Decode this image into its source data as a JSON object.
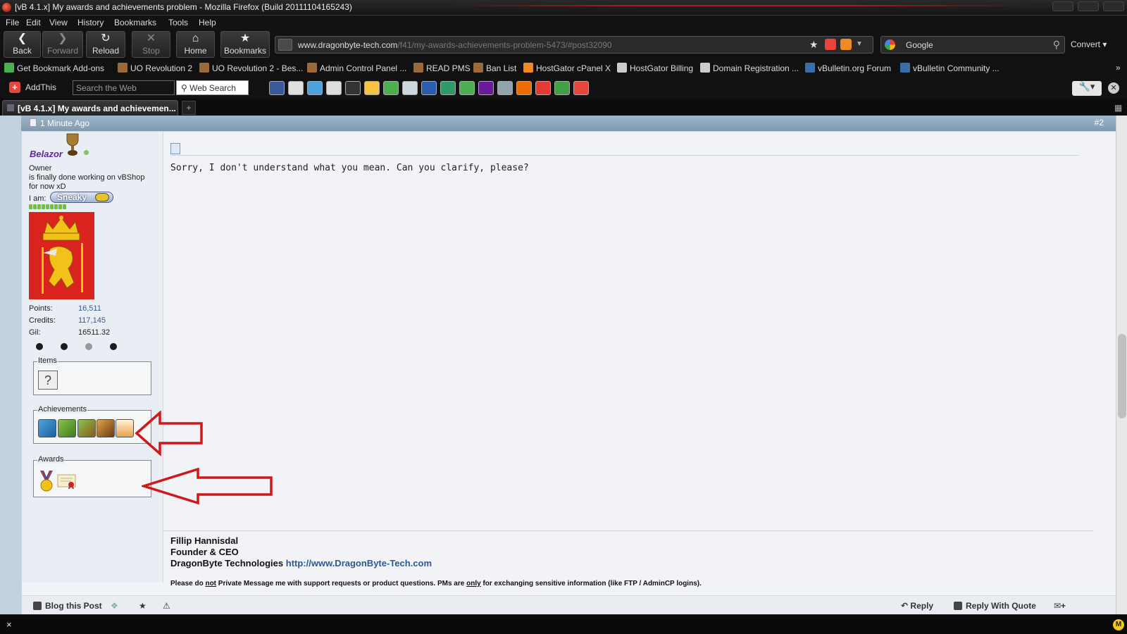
{
  "window": {
    "title": "[vB 4.1.x] My awards and achievements problem - Mozilla Firefox (Build 20111104165243)"
  },
  "menu": [
    "File",
    "Edit",
    "View",
    "History",
    "Bookmarks",
    "Tools",
    "Help"
  ],
  "nav": {
    "back": "Back",
    "forward": "Forward",
    "reload": "Reload",
    "stop": "Stop",
    "home": "Home",
    "bookmarks": "Bookmarks"
  },
  "address": {
    "url_domain": "www.dragonbyte-tech.com",
    "url_path": "/f41/my-awards-achievements-problem-5473/#post32090"
  },
  "search": {
    "engine_text": "Google",
    "convert_label": "Convert"
  },
  "bookmarks_bar": [
    {
      "label": "Get Bookmark Add-ons",
      "icon": "puzzle-icon",
      "color": "#4caf50"
    },
    {
      "label": "UO Revolution 2",
      "icon": "dragon-icon",
      "color": "#9a6a3a"
    },
    {
      "label": "UO Revolution 2 - Bes...",
      "icon": "dragon-icon",
      "color": "#9a6a3a"
    },
    {
      "label": "Admin Control Panel ...",
      "icon": "dragon-icon",
      "color": "#9a6a3a"
    },
    {
      "label": "READ PMS",
      "icon": "dragon-icon",
      "color": "#9a6a3a"
    },
    {
      "label": "Ban List",
      "icon": "dragon-icon",
      "color": "#9a6a3a"
    },
    {
      "label": "HostGator cPanel X",
      "icon": "cpanel-icon",
      "color": "#f08a24"
    },
    {
      "label": "HostGator Billing",
      "icon": "page-icon",
      "color": "#cccccc"
    },
    {
      "label": "Domain Registration ...",
      "icon": "page-icon",
      "color": "#cccccc"
    },
    {
      "label": "vBulletin.org Forum",
      "icon": "vb-icon",
      "color": "#3b6ea8"
    },
    {
      "label": "vBulletin Community ...",
      "icon": "vb-icon",
      "color": "#3b6ea8"
    }
  ],
  "addthis_bar": {
    "label": "AddThis",
    "search_placeholder": "Search the Web",
    "search_button": "Web Search",
    "share_icon_colors": [
      "#3b5998",
      "#e0e0e0",
      "#4aa3df",
      "#dddddd",
      "#333333",
      "#f6c244",
      "#4caf50",
      "#cfd8dc",
      "#2a5db0",
      "#2e9a6a",
      "#4caf50",
      "#6a1b9a",
      "#90a4ae",
      "#ef6c00",
      "#e53935",
      "#43a047",
      "#e8453c"
    ]
  },
  "tab": {
    "label": "[vB 4.1.x] My awards and achievemen...",
    "new_tab": "+"
  },
  "post": {
    "time": "1 Minute Ago",
    "number": "#2",
    "username": "Belazor",
    "user_title": "Owner",
    "status_line1": "is finally done working on vBShop",
    "status_line2": "for now xD",
    "mood_label": "I am:",
    "mood_value": "Sneaky",
    "stats": [
      {
        "label": "Points:",
        "value": "16,511"
      },
      {
        "label": "Credits:",
        "value": "117,145"
      },
      {
        "label": "Gil:",
        "value": "16511.32"
      }
    ],
    "items_legend": "Items",
    "achievements_legend": "Achievements",
    "awards_legend": "Awards",
    "message": "Sorry, I don't understand what you mean. Can you clarify, please?",
    "signature": {
      "name": "Fillip Hannisdal",
      "role": "Founder & CEO",
      "company": "DragonByte Technologies",
      "link": "http://www.DragonByte-Tech.com",
      "note_before": "Please do ",
      "note_not": "not",
      "note_mid": " Private Message me with support requests or product questions. PMs are ",
      "note_only": "only",
      "note_after": " for exchanging sensitive information (like FTP / AdminCP logins)."
    },
    "footer": {
      "blog": "Blog this Post",
      "reply": "Reply",
      "reply_quote": "Reply With Quote"
    }
  },
  "statusbar": {
    "close": "×"
  }
}
